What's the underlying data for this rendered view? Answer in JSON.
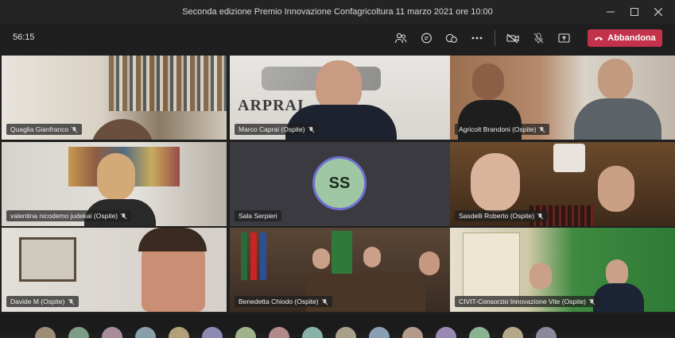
{
  "window": {
    "title": "Seconda edizione Premio Innovazione Confagricoltura 11 marzo 2021 ore 10:00",
    "minimize_icon": "minimize-icon",
    "maximize_icon": "maximize-icon",
    "close_icon": "close-icon"
  },
  "meeting": {
    "timer": "56:15",
    "leave_label": "Abbandona",
    "colors": {
      "leave": "#c4314b",
      "avatar_ring": "#6f6fd1",
      "avatar_bg": "#9fc7a3"
    }
  },
  "toolbar_icons": [
    "participants-icon",
    "chat-icon",
    "reactions-icon",
    "more-options-icon",
    "camera-off-icon",
    "mic-off-icon",
    "share-screen-icon"
  ],
  "participants": [
    {
      "name": "Quaglia Gianfranco",
      "bg": "#cfc7bb"
    },
    {
      "name": "Marco Caprai (Ospite)",
      "bg": "#c9c6c1"
    },
    {
      "name": "Agricolt Brandoni (Ospite)",
      "bg": "#8a7566"
    },
    {
      "name": "valentina nicodemo judekai (Ospite)",
      "bg": "#c7c3bd"
    },
    {
      "name": "Sala Serpieri",
      "bg": "#3b3a40",
      "initials": "SS"
    },
    {
      "name": "Sasdelli Roberto (Ospite)",
      "bg": "#6a4a2d"
    },
    {
      "name": "Davide M (Ospite)",
      "bg": "#d2cdc6"
    },
    {
      "name": "Benedetta Chiodo (Ospite)",
      "bg": "#4a3a30"
    },
    {
      "name": "CIVIT-Consorzio Innovazione Vite (Ospite)",
      "bg": "#7a8a4a"
    }
  ]
}
